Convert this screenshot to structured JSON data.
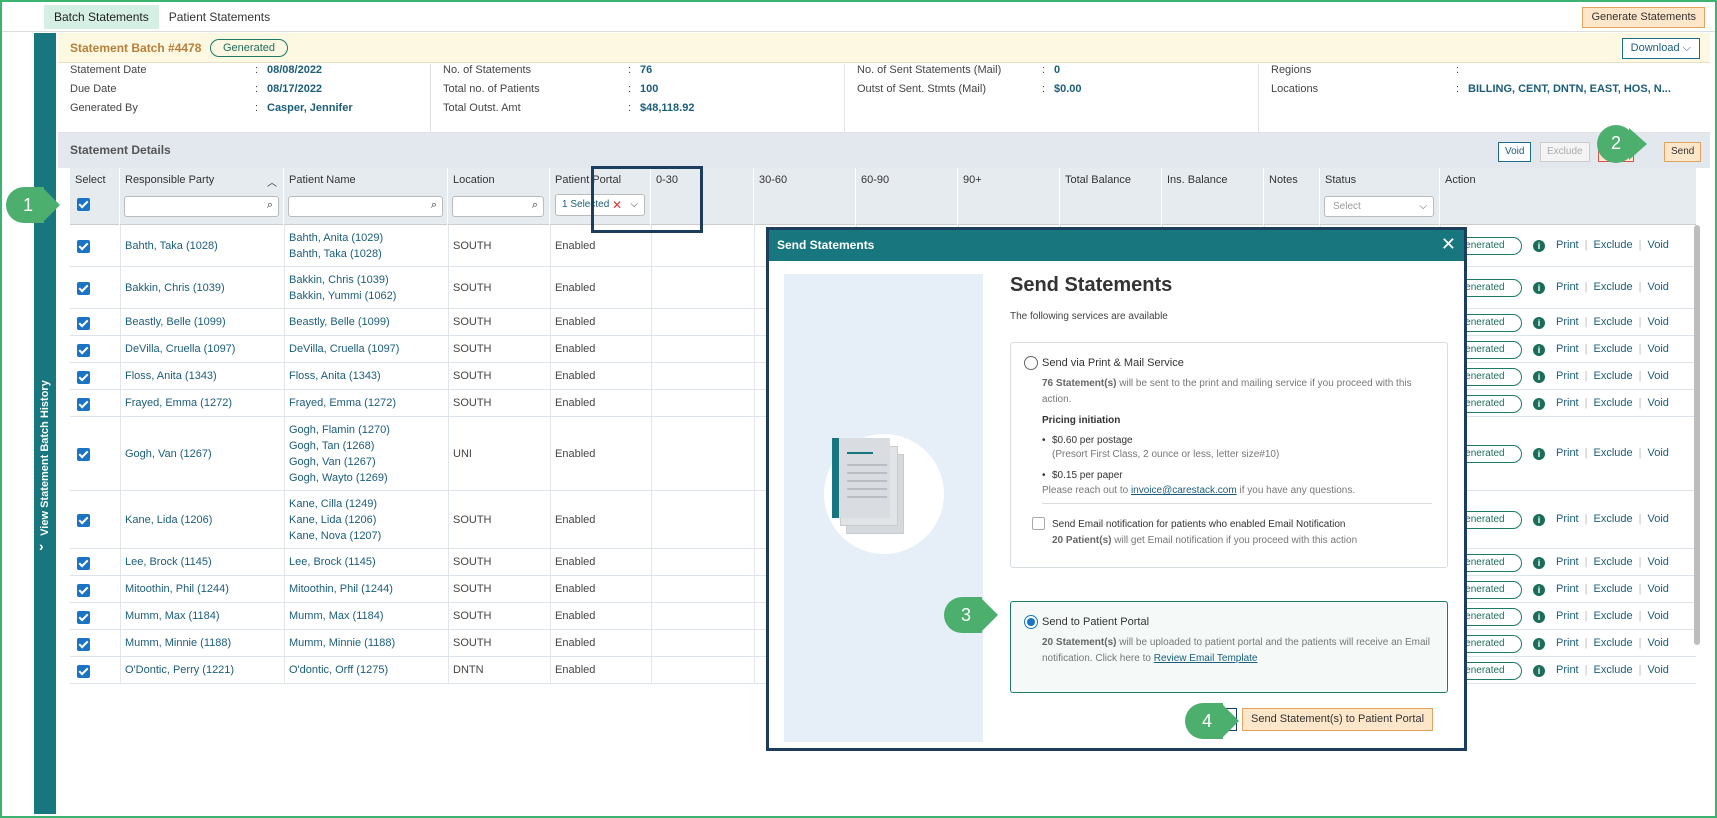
{
  "top_tabs": [
    "Batch Statements",
    "Patient Statements"
  ],
  "generate_button": "Generate Statements",
  "sidebar_label": "View Statement Batch History",
  "sidebar_chevron": "›",
  "batch": {
    "title": "Statement Batch #4478",
    "status": "Generated",
    "download": "Download"
  },
  "info": {
    "statement_date_label": "Statement Date",
    "statement_date": "08/08/2022",
    "due_date_label": "Due Date",
    "due_date": "08/17/2022",
    "generated_by_label": "Generated By",
    "generated_by": "Casper, Jennifer",
    "no_statements_label": "No. of Statements",
    "no_statements": "76",
    "total_patients_label": "Total no. of Patients",
    "total_patients": "100",
    "total_outst_label": "Total Outst. Amt",
    "total_outst": "$48,118.92",
    "sent_mail_label": "No. of Sent Statements (Mail)",
    "sent_mail": "0",
    "outst_sent_label": "Outst of Sent. Stmts (Mail)",
    "outst_sent": "$0.00",
    "regions_label": "Regions",
    "regions": "",
    "locations_label": "Locations",
    "locations": "BILLING, CENT, DNTN, EAST, HOS, N..."
  },
  "details": {
    "title": "Statement Details",
    "void": "Void",
    "exclude": "Exclude",
    "send": "Send"
  },
  "columns": {
    "select": "Select",
    "responsible_party": "Responsible Party",
    "patient_name": "Patient Name",
    "location": "Location",
    "patient_portal": "Patient Portal",
    "d0_30": "0-30",
    "d30_60": "30-60",
    "d60_90": "60-90",
    "d90": "90+",
    "total_balance": "Total Balance",
    "ins_balance": "Ins. Balance",
    "notes": "Notes",
    "status": "Status",
    "action": "Action"
  },
  "filters": {
    "portal_selected": "1 Selected",
    "status_placeholder": "Select"
  },
  "row_status": "Generated",
  "row_actions": {
    "print": "Print",
    "exclude": "Exclude",
    "void": "Void"
  },
  "rows": [
    {
      "rp": "Bahth, Taka (1028)",
      "patients": [
        "Bahth, Anita (1029)",
        "Bahth, Taka (1028)"
      ],
      "location": "SOUTH",
      "portal": "Enabled"
    },
    {
      "rp": "Bakkin, Chris (1039)",
      "patients": [
        "Bakkin, Chris (1039)",
        "Bakkin, Yummi (1062)"
      ],
      "location": "SOUTH",
      "portal": "Enabled"
    },
    {
      "rp": "Beastly, Belle (1099)",
      "patients": [
        "Beastly, Belle (1099)"
      ],
      "location": "SOUTH",
      "portal": "Enabled"
    },
    {
      "rp": "DeVilla, Cruella (1097)",
      "patients": [
        "DeVilla, Cruella (1097)"
      ],
      "location": "SOUTH",
      "portal": "Enabled"
    },
    {
      "rp": "Floss, Anita (1343)",
      "patients": [
        "Floss, Anita (1343)"
      ],
      "location": "SOUTH",
      "portal": "Enabled"
    },
    {
      "rp": "Frayed, Emma (1272)",
      "patients": [
        "Frayed, Emma (1272)"
      ],
      "location": "SOUTH",
      "portal": "Enabled"
    },
    {
      "rp": "Gogh, Van (1267)",
      "patients": [
        "Gogh, Flamin (1270)",
        "Gogh, Tan (1268)",
        "Gogh, Van (1267)",
        "Gogh, Wayto (1269)"
      ],
      "location": "UNI",
      "portal": "Enabled"
    },
    {
      "rp": "Kane, Lida (1206)",
      "patients": [
        "Kane, Cilla (1249)",
        "Kane, Lida (1206)",
        "Kane, Nova (1207)"
      ],
      "location": "SOUTH",
      "portal": "Enabled"
    },
    {
      "rp": "Lee, Brock (1145)",
      "patients": [
        "Lee, Brock (1145)"
      ],
      "location": "SOUTH",
      "portal": "Enabled"
    },
    {
      "rp": "Mitoothin, Phil (1244)",
      "patients": [
        "Mitoothin, Phil (1244)"
      ],
      "location": "SOUTH",
      "portal": "Enabled"
    },
    {
      "rp": "Mumm, Max (1184)",
      "patients": [
        "Mumm, Max (1184)"
      ],
      "location": "SOUTH",
      "portal": "Enabled"
    },
    {
      "rp": "Mumm, Minnie (1188)",
      "patients": [
        "Mumm, Minnie (1188)"
      ],
      "location": "SOUTH",
      "portal": "Enabled"
    },
    {
      "rp": "O'Dontic, Perry (1221)",
      "patients": [
        "O'dontic, Orff (1275)"
      ],
      "location": "DNTN",
      "portal": "Enabled"
    }
  ],
  "modal": {
    "header": "Send Statements",
    "close": "✕",
    "title": "Send Statements",
    "subtitle": "The following services are available",
    "print_mail": {
      "label": "Send via Print & Mail Service",
      "count": "76 Statement(s)",
      "desc": " will be sent to the print and mailing service if you proceed with this action.",
      "pricing_title": "Pricing initiation",
      "bullet1": "$0.60 per postage",
      "bullet1_note": "(Presort First Class, 2 ounce or less, letter size#10)",
      "bullet2": "$0.15 per paper",
      "reach_pre": "Please reach out to ",
      "reach_email": "invoice@carestack.com",
      "reach_post": " if you have any questions.",
      "email_notif": "Send Email notification for patients who enabled Email Notification",
      "email_count": "20 Patient(s)",
      "email_desc": " will get Email notification if you proceed with this action"
    },
    "portal": {
      "label": "Send to Patient Portal",
      "count": "20 Statement(s)",
      "desc": " will be uploaded to patient portal and the patients will receive an Email notification. Click here to ",
      "link": "Review Email Template"
    },
    "submit": "Send Statement(s) to Patient Portal"
  },
  "steps": [
    "1",
    "2",
    "3",
    "4"
  ]
}
